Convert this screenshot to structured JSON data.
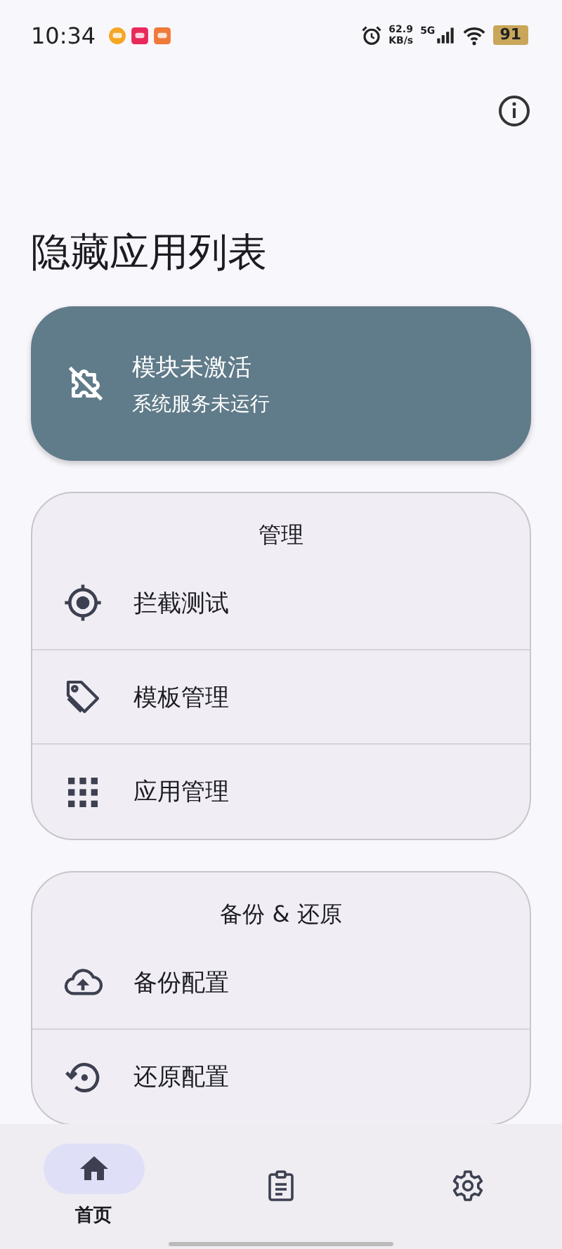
{
  "status_bar": {
    "time": "10:34",
    "net_speed": "62.9",
    "net_unit": "KB/s",
    "network": "5G",
    "battery": "91"
  },
  "title": "隐藏应用列表",
  "module_status": {
    "title": "模块未激活",
    "subtitle": "系统服务未运行",
    "active": false
  },
  "sections": [
    {
      "title": "管理",
      "items": [
        {
          "kind": "target",
          "label": "拦截测试"
        },
        {
          "kind": "tag",
          "label": "模板管理"
        },
        {
          "kind": "grid",
          "label": "应用管理"
        }
      ]
    },
    {
      "title": "备份 & 还原",
      "items": [
        {
          "kind": "upload",
          "label": "备份配置"
        },
        {
          "kind": "restore",
          "label": "还原配置"
        }
      ]
    }
  ],
  "nav": [
    {
      "kind": "home",
      "label": "首页",
      "selected": true
    },
    {
      "kind": "clipboard",
      "selected": false
    },
    {
      "kind": "settings",
      "selected": false
    }
  ]
}
